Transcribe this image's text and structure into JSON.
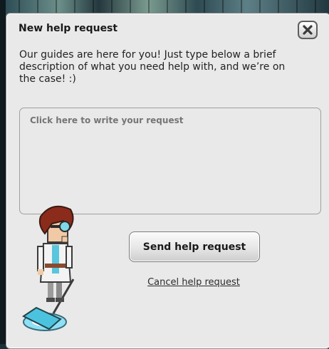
{
  "dialog": {
    "title": "New help request",
    "description": "Our guides are here for you! Just type below a brief description of what you need help with, and we’re on the case! :)",
    "request_placeholder": "Click here to write your request",
    "send_label": "Send help request",
    "cancel_label": "Cancel help request"
  },
  "icons": {
    "close": "close-icon",
    "avatar": "guide-avatar"
  },
  "colors": {
    "dialog_bg": "#e9e9e9",
    "text": "#1a1a1a",
    "placeholder": "#a9a9a9"
  }
}
